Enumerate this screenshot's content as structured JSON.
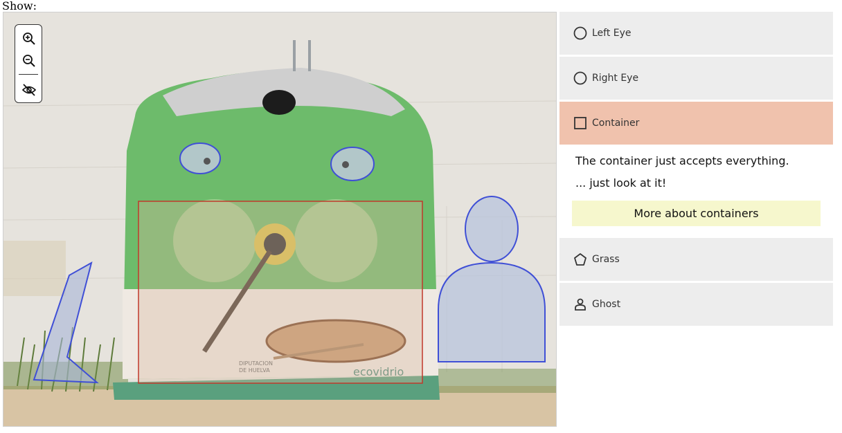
{
  "header": {
    "show_label": "Show:"
  },
  "toolbar": {
    "zoom_in_icon": "zoom-in-icon",
    "zoom_out_icon": "zoom-out-icon",
    "visibility_icon": "eye-off-icon"
  },
  "image": {
    "sticker_texts": [
      "DIPUTACION",
      "DE HUELVA",
      "ecovidrio"
    ]
  },
  "annotations": [
    {
      "label": "Left Eye",
      "shape": "circle",
      "color": "#3f4fd6"
    },
    {
      "label": "Right Eye",
      "shape": "circle",
      "color": "#3f4fd6"
    },
    {
      "label": "Container",
      "shape": "rectangle",
      "color": "#c0392b",
      "active": true
    },
    {
      "label": "Grass",
      "shape": "polygon",
      "color": "#3f4fd6"
    },
    {
      "label": "Ghost",
      "shape": "person",
      "color": "#3f4fd6"
    }
  ],
  "details": {
    "line1": "The container just accepts everything.",
    "line2": "... just look at it!",
    "button": "More about containers"
  },
  "colors": {
    "active_item": "#f0c2ad",
    "item_bg": "#ededed",
    "button_bg": "#f6f7cd"
  }
}
